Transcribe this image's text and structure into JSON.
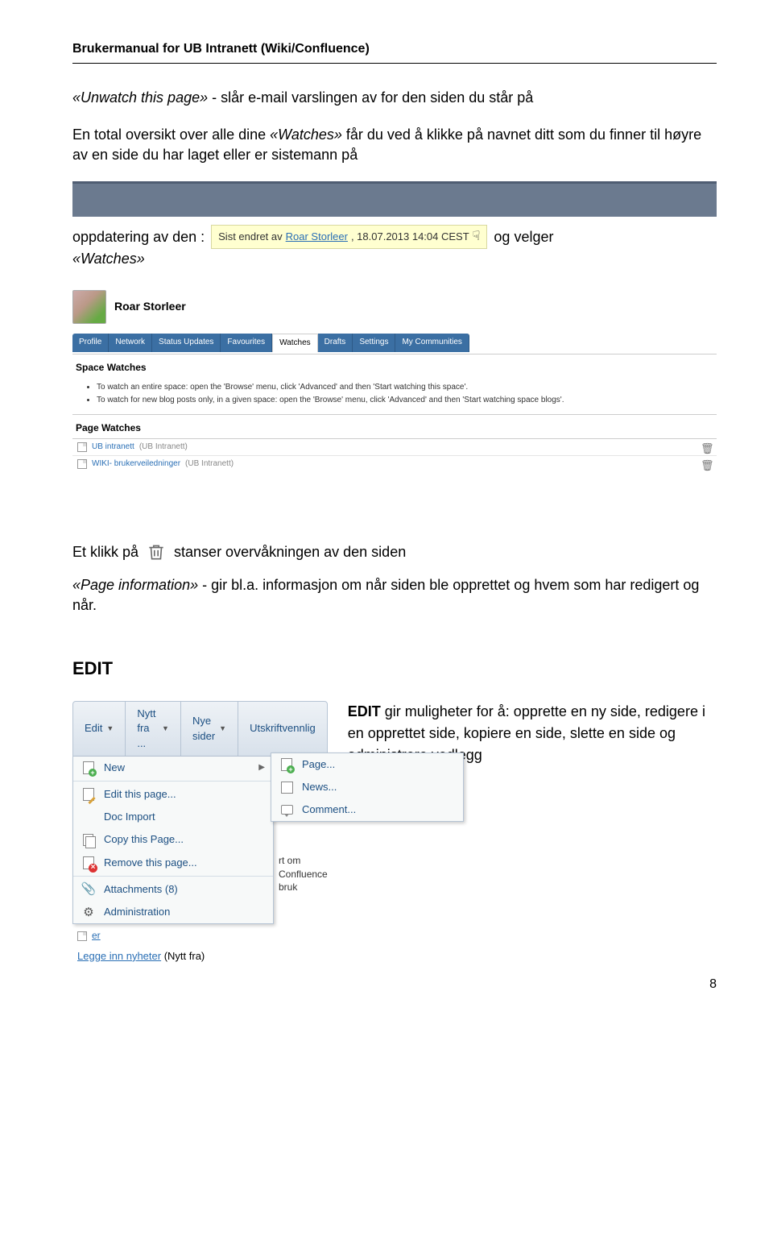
{
  "doc_header": "Brukermanual for UB Intranett (Wiki/Confluence)",
  "p1_italic": "«Unwatch this page»",
  "p1_rest": " - slår e-mail varslingen av for den siden du står på",
  "p2_a": "En total oversikt over alle dine ",
  "p2_italic": "«Watches»",
  "p2_b": " får du ved å klikke på navnet ditt som du finner til høyre av en side du har laget eller er sistemann på",
  "inline_a": "oppdatering av den :",
  "pill_prefix": "Sist endret av",
  "pill_link": "Roar Storleer",
  "pill_date": ", 18.07.2013 14:04 CEST",
  "inline_b": "og velger",
  "watches_italic": "«Watches»",
  "profile_name": "Roar Storleer",
  "tabs": [
    "Profile",
    "Network",
    "Status Updates",
    "Favourites",
    "Watches",
    "Drafts",
    "Settings",
    "My Communities"
  ],
  "tabs_active_index": 4,
  "space_watches_h": "Space Watches",
  "help_items": [
    "To watch an entire space: open the 'Browse' menu, click 'Advanced' and then 'Start watching this space'.",
    "To watch for new blog posts only, in a given space: open the 'Browse' menu, click 'Advanced' and then 'Start watching space blogs'."
  ],
  "page_watches_h": "Page Watches",
  "watch_rows": [
    {
      "main": "UB intranett",
      "sub": "(UB Intranett)"
    },
    {
      "main": "WIKI- brukerveiledninger",
      "sub": "(UB Intranett)"
    }
  ],
  "click_a": "Et klikk på",
  "click_b": "stanser overvåkningen av den siden",
  "pi_italic": "«Page information»",
  "pi_rest": " - gir bl.a. informasjon om når siden ble opprettet og hvem som har redigert og når.",
  "edit_heading": "EDIT",
  "toolbar_items": [
    "Edit",
    "Nytt fra ...",
    "Nye sider",
    "Utskriftvennlig"
  ],
  "dropdown_items": [
    {
      "label": "New",
      "icon": "page-plus",
      "caret": true
    },
    {
      "label": "Edit this page...",
      "icon": "page-pencil"
    },
    {
      "label": "Doc Import",
      "icon": "none"
    },
    {
      "label": "Copy this Page...",
      "icon": "copy"
    },
    {
      "label": "Remove this page...",
      "icon": "page-x"
    },
    {
      "label": "Attachments (8)",
      "icon": "clip"
    },
    {
      "label": "Administration",
      "icon": "gear"
    }
  ],
  "dd_sep_after": [
    0,
    4
  ],
  "submenu_items": [
    {
      "label": "Page...",
      "icon": "page-plus"
    },
    {
      "label": "News...",
      "icon": "news"
    },
    {
      "label": "Comment...",
      "icon": "comment"
    }
  ],
  "partial_text": "rt om Confluence bruk",
  "below_links": [
    {
      "text": "er"
    }
  ],
  "cutoff": {
    "link": "Legge inn nyheter",
    "rest": " (Nytt fra)"
  },
  "edit_right_bold": "EDIT",
  "edit_right_text": " gir muligheter for å: opprette en ny side, redigere i en opprettet side, kopiere en side, slette en side og administrere vedlegg",
  "page_number": "8"
}
